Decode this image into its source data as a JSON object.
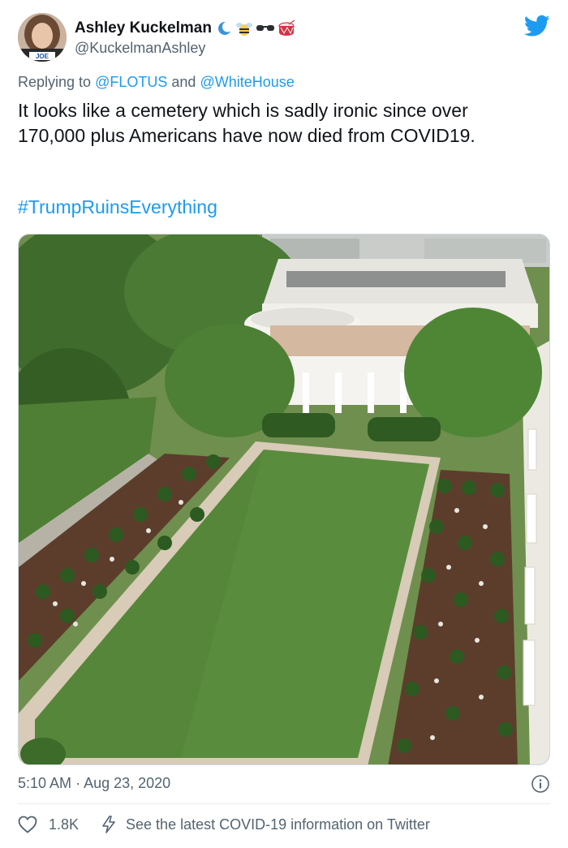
{
  "tweet": {
    "author": {
      "display_name": "Ashley Kuckelman",
      "handle": "@KuckelmanAshley",
      "name_emojis": [
        "crescent-moon-icon",
        "bee-icon",
        "sunglasses-icon",
        "drum-icon"
      ]
    },
    "reply_to": {
      "prefix": "Replying to",
      "mentions": [
        "@FLOTUS",
        "@WhiteHouse"
      ],
      "joiner": "and"
    },
    "text": "It looks like a cemetery which is sadly ironic since over 170,000 plus Americans have now died from COVID19.",
    "hashtag": "#TrumpRuinsEverything",
    "photo": {
      "subject": "rose-garden-photo"
    },
    "time": "5:10 AM",
    "separator": "·",
    "date": "Aug 23, 2020",
    "likes": "1.8K",
    "info_link": "See the latest COVID-19 information on Twitter"
  },
  "avatar_badge": "JOE",
  "colors": {
    "accent": "#1d9bf0",
    "muted": "#536471",
    "text": "#0f1419"
  }
}
